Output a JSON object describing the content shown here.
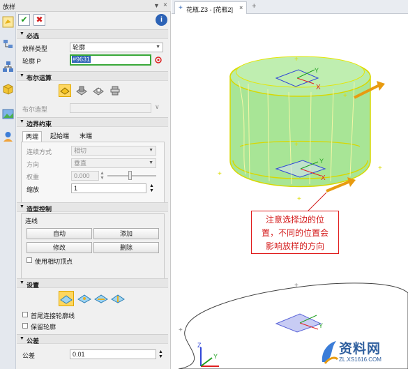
{
  "panel": {
    "title": "放样",
    "pin_icon": "pin-icon",
    "close_icon": "close-icon",
    "confirm_icon": "check-icon",
    "cancel_icon": "cancel-x-icon",
    "info_icon": "info-icon",
    "sections": {
      "required": "必选",
      "boolean": "布尔运算",
      "boundary": "边界约束",
      "shape_control": "造型控制",
      "settings": "设置",
      "tolerance": "公差"
    },
    "loft_type_label": "放样类型",
    "loft_type_value": "轮廓",
    "profile_label": "轮廓 P",
    "profile_value": "#9631",
    "boolean_shape_label": "布尔造型",
    "boundary_tabs": [
      "两端",
      "起始端",
      "末端"
    ],
    "connect_mode_label": "连续方式",
    "connect_mode_value": "相切",
    "direction_label": "方向",
    "direction_value": "垂直",
    "weight_label": "权重",
    "weight_value": "0.000",
    "scale_label": "缩放",
    "scale_value": "1",
    "connect_line_label": "连线",
    "auto_label": "自动",
    "add_label": "添加",
    "modify_label": "修改",
    "delete_label": "删除",
    "use_tangent_vertex_label": "使用相切顶点",
    "join_ends_label": "首尾连接轮廓线",
    "keep_profile_label": "保留轮廓",
    "tolerance_label": "公差",
    "tolerance_value": "0.01"
  },
  "viewport": {
    "tab_label": "花瓶.Z3 - [花瓶2]",
    "tab_close": "×",
    "new_tab": "+",
    "note_lines": [
      "注意选择边的位",
      "置，不同的位置会",
      "影响放样的方向"
    ],
    "axis_labels": {
      "x": "X",
      "y": "Y",
      "z": "Z"
    },
    "watermark_main": "资料网",
    "watermark_sub": "ZL.XS1616.COM"
  },
  "colors": {
    "accent_blue": "#2d63b6",
    "profile_field_border": "#38a838",
    "body_fill": "#9be08a",
    "body_edge": "#d8d800",
    "arrow": "#f0a020",
    "note_red": "#d41c1c",
    "plane_blue": "#7f86e8"
  }
}
